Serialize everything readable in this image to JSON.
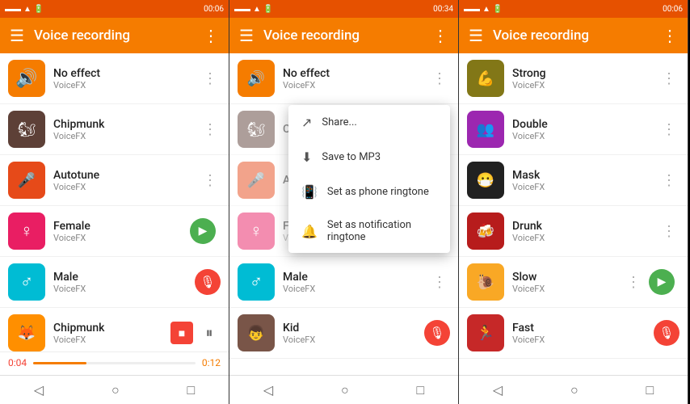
{
  "panels": [
    {
      "id": "panel1",
      "statusBar": {
        "left": [
          "📱",
          "📶",
          "🔋"
        ],
        "time": "00:06"
      },
      "appBar": {
        "title": "Voice recording",
        "menuIcon": "☰",
        "moreIcon": "⋮"
      },
      "items": [
        {
          "id": "no-effect",
          "label": "No effect",
          "sub": "VoiceFX",
          "iconBg": "#f57c00",
          "icon": "🔊",
          "hasMore": true,
          "hasMic": false,
          "hasPlay": false
        },
        {
          "id": "chipmunk",
          "label": "Chipmunk",
          "sub": "VoiceFX",
          "iconBg": "#5d4037",
          "icon": "🐿",
          "hasMore": true,
          "hasMic": false,
          "hasPlay": false
        },
        {
          "id": "autotune",
          "label": "Autotune",
          "sub": "VoiceFX",
          "iconBg": "#e64a19",
          "icon": "🎤",
          "hasMore": true,
          "hasMic": false,
          "hasPlay": false
        },
        {
          "id": "female",
          "label": "Female",
          "sub": "VoiceFX",
          "iconBg": "#e91e63",
          "icon": "♀",
          "hasMore": false,
          "hasMic": false,
          "hasPlay": true,
          "playColor": "#4caf50"
        },
        {
          "id": "male",
          "label": "Male",
          "sub": "VoiceFX",
          "iconBg": "#00bcd4",
          "icon": "♂",
          "hasMore": false,
          "hasMic": true,
          "hasPlay": false
        },
        {
          "id": "chipmunk2",
          "label": "Chipmunk",
          "sub": "VoiceFX",
          "iconBg": "#ff8f00",
          "icon": "🦊",
          "hasMore": false,
          "hasMic": false,
          "hasPlay": false,
          "isRecording": true
        }
      ],
      "recordingBar": {
        "timeStart": "0:04",
        "timeEnd": "0:12",
        "progress": 33
      }
    },
    {
      "id": "panel2",
      "statusBar": {
        "left": [
          "📱",
          "📶",
          "🔋"
        ],
        "time": "00:34"
      },
      "appBar": {
        "title": "Voice recording",
        "menuIcon": "☰",
        "moreIcon": "⋮"
      },
      "items": [
        {
          "id": "no-effect",
          "label": "No effect",
          "sub": "VoiceFX",
          "iconBg": "#f57c00",
          "icon": "🔊",
          "hasMore": true,
          "hasMic": false,
          "hasPlay": false
        },
        {
          "id": "chipmunk",
          "label": "Ch...",
          "sub": "",
          "iconBg": "#5d4037",
          "icon": "🐿",
          "hasMore": false,
          "hasMic": false,
          "hasPlay": false,
          "dimmed": true
        },
        {
          "id": "autotune",
          "label": "Au...",
          "sub": "",
          "iconBg": "#e64a19",
          "icon": "🎤",
          "hasMore": false,
          "hasMic": false,
          "hasPlay": false,
          "dimmed": true
        },
        {
          "id": "female",
          "label": "Fe...",
          "sub": "VoiceFX",
          "iconBg": "#e91e63",
          "icon": "♀",
          "hasMore": false,
          "hasMic": false,
          "hasPlay": false,
          "dimmed": true
        },
        {
          "id": "male",
          "label": "Male",
          "sub": "VoiceFX",
          "iconBg": "#00bcd4",
          "icon": "♂",
          "hasMore": true,
          "hasMic": false,
          "hasPlay": false
        },
        {
          "id": "kid",
          "label": "Kid",
          "sub": "VoiceFX",
          "iconBg": "#795548",
          "icon": "👦",
          "hasMore": false,
          "hasMic": true,
          "hasPlay": false
        }
      ],
      "dropdown": {
        "visible": true,
        "items": [
          {
            "id": "share",
            "label": "Share...",
            "icon": "↗"
          },
          {
            "id": "save-mp3",
            "label": "Save to MP3",
            "icon": "⬇"
          },
          {
            "id": "phone-ringtone",
            "label": "Set as phone ringtone",
            "icon": "📳"
          },
          {
            "id": "notification-ringtone",
            "label": "Set as notification ringtone",
            "icon": "🔔"
          }
        ]
      }
    },
    {
      "id": "panel3",
      "statusBar": {
        "left": [
          "📱",
          "📶",
          "🔋"
        ],
        "time": "00:06"
      },
      "appBar": {
        "title": "Voice recording",
        "menuIcon": "☰",
        "moreIcon": "⋮"
      },
      "items": [
        {
          "id": "strong",
          "label": "Strong",
          "sub": "VoiceFX",
          "iconBg": "#827717",
          "icon": "💪",
          "hasMore": true,
          "hasMic": false,
          "hasPlay": false
        },
        {
          "id": "double",
          "label": "Double",
          "sub": "VoiceFX",
          "iconBg": "#9c27b0",
          "icon": "👥",
          "hasMore": true,
          "hasMic": false,
          "hasPlay": false
        },
        {
          "id": "mask",
          "label": "Mask",
          "sub": "VoiceFX",
          "iconBg": "#212121",
          "icon": "😷",
          "hasMore": true,
          "hasMic": false,
          "hasPlay": false
        },
        {
          "id": "drunk",
          "label": "Drunk",
          "sub": "VoiceFX",
          "iconBg": "#b71c1c",
          "icon": "🍻",
          "hasMore": true,
          "hasMic": false,
          "hasPlay": false
        },
        {
          "id": "slow",
          "label": "Slow",
          "sub": "VoiceFX",
          "iconBg": "#f9a825",
          "icon": "🐌",
          "hasMore": true,
          "hasMic": false,
          "hasPlay": true,
          "playColor": "#4caf50"
        },
        {
          "id": "fast",
          "label": "Fast",
          "sub": "VoiceFX",
          "iconBg": "#c62828",
          "icon": "🏃",
          "hasMore": false,
          "hasMic": true,
          "hasPlay": false
        }
      ]
    }
  ],
  "navBar": {
    "back": "◁",
    "home": "○",
    "recents": "□"
  }
}
